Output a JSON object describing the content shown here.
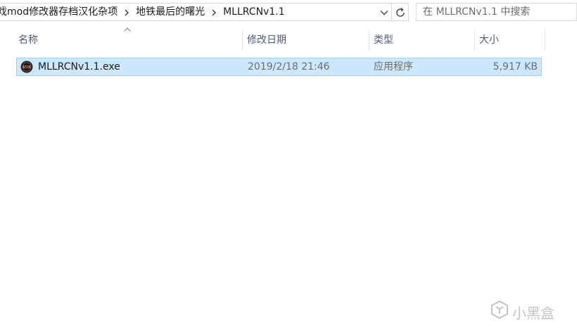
{
  "address_bar": {
    "breadcrumbs": [
      {
        "label": "戏mod修改器存档汉化杂项"
      },
      {
        "label": "地铁最后的曙光"
      },
      {
        "label": "MLLRCNv1.1"
      }
    ]
  },
  "search": {
    "placeholder": "在 MLLRCNv1.1 中搜索"
  },
  "columns": {
    "name": "名称",
    "date_modified": "修改日期",
    "type": "类型",
    "size": "大小"
  },
  "files": [
    {
      "name": "MLLRCNv1.1.exe",
      "date_modified": "2019/2/18 21:46",
      "type": "应用程序",
      "size": "5,917 KB",
      "selected": true,
      "icon": "app-exe-icon"
    }
  ],
  "watermark": {
    "text": "小黑盒"
  },
  "colors": {
    "selection_fill": "#cce8ff",
    "selection_border": "#99d1ff",
    "header_text": "#4d5b7c",
    "secondary_text": "#6d6d6d"
  }
}
